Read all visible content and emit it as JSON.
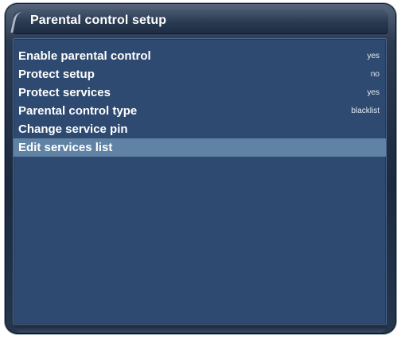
{
  "window": {
    "title": "Parental control setup"
  },
  "menu": {
    "items": [
      {
        "label": "Enable parental control",
        "value": "yes"
      },
      {
        "label": "Protect setup",
        "value": "no"
      },
      {
        "label": "Protect services",
        "value": "yes"
      },
      {
        "label": "Parental control type",
        "value": "blacklist"
      },
      {
        "label": "Change service pin",
        "value": ""
      },
      {
        "label": "Edit services list",
        "value": ""
      }
    ],
    "selected_index": 5
  },
  "colors": {
    "panel_background": "#2e4a70",
    "selection_highlight": "#5f82a5",
    "text": "#ffffff"
  }
}
